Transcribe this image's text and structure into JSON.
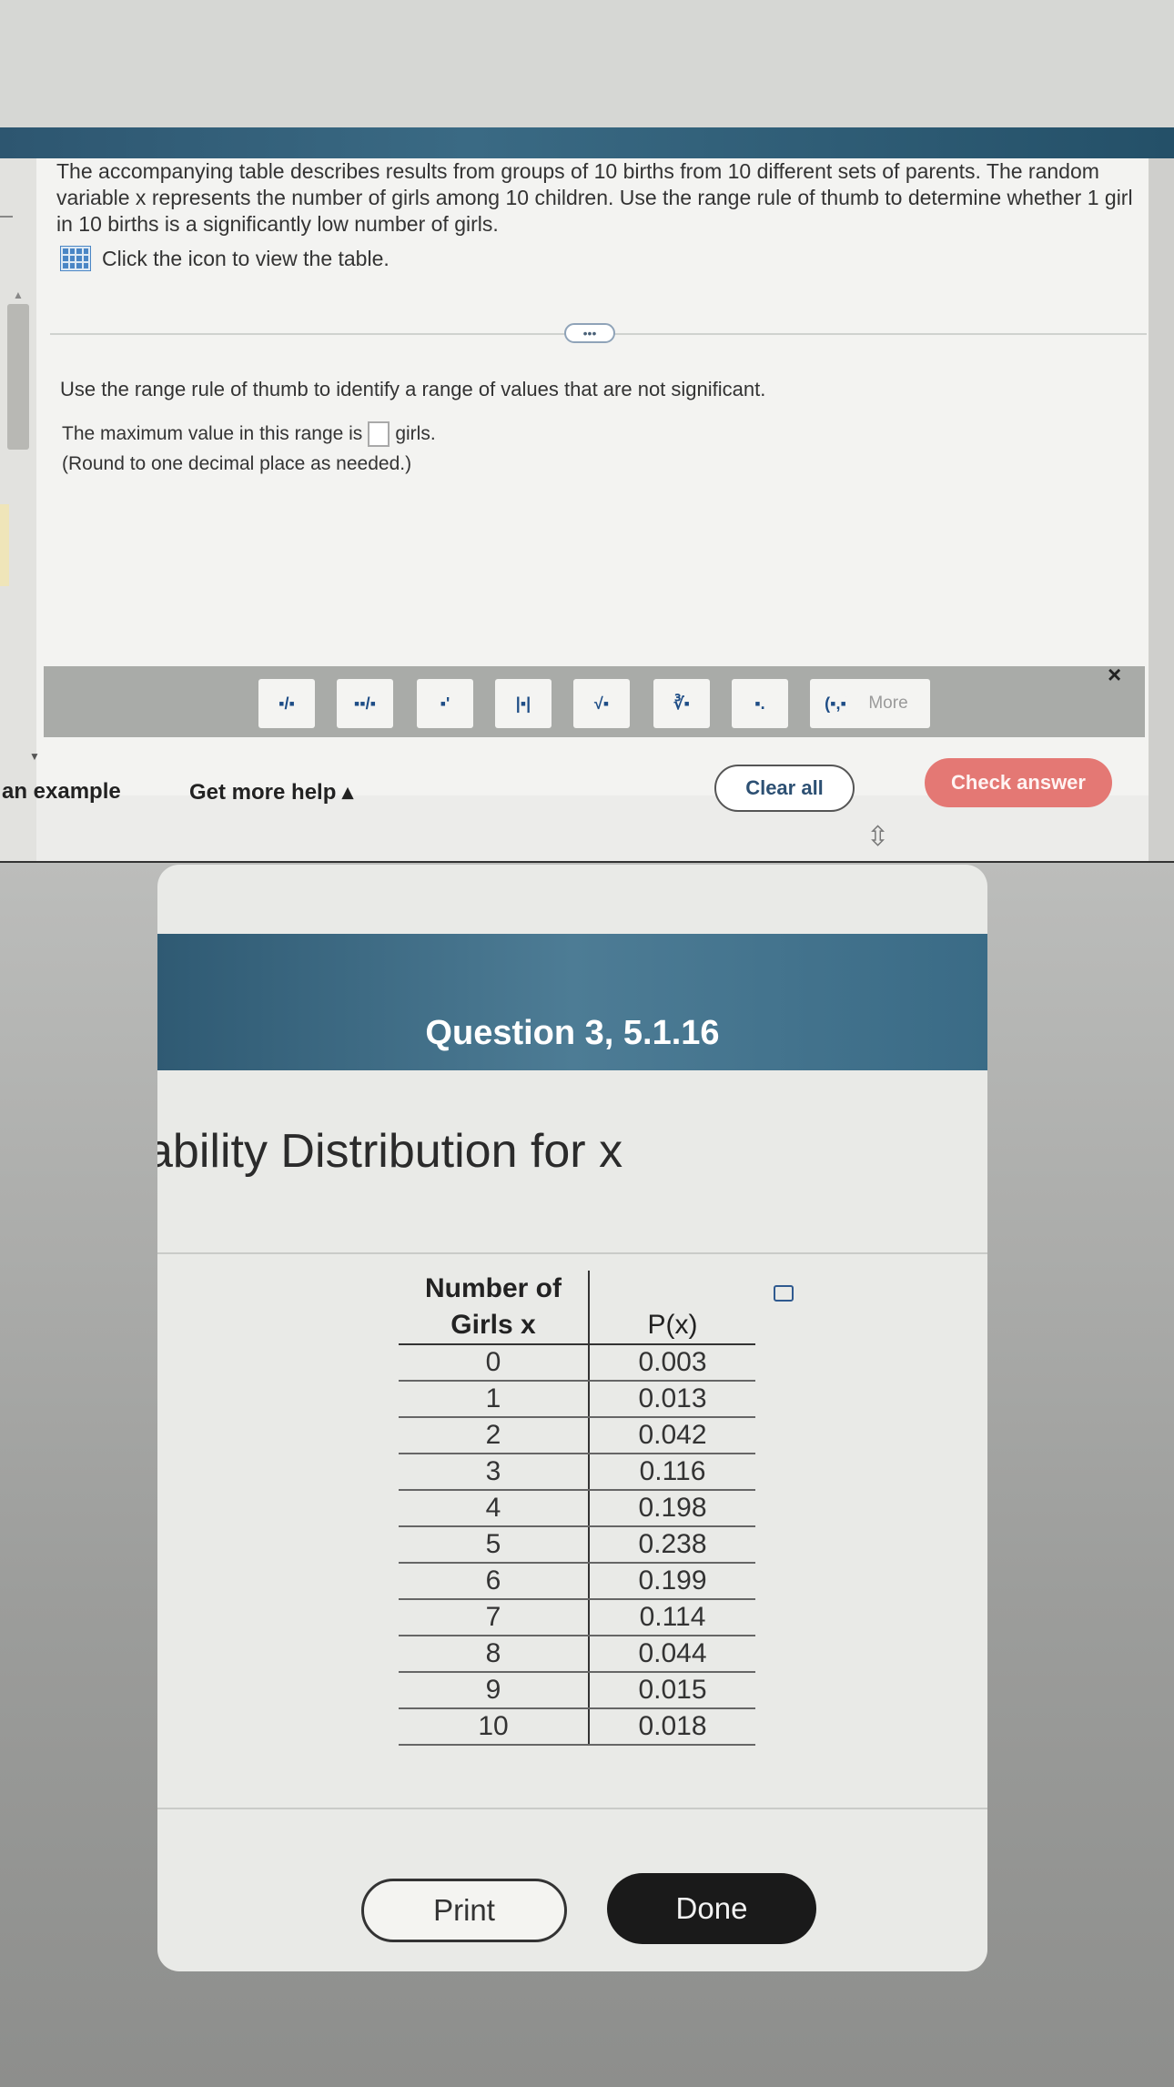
{
  "question": {
    "text": "The accompanying table describes results from groups of 10 births from 10 different sets of parents. The random variable x represents the number of girls among 10 children. Use the range rule of thumb to determine whether 1 girl in 10 births is a significantly low number of girls.",
    "table_link": "Click the icon to view the table.",
    "expand_dots": "•••",
    "instruction": "Use the range rule of thumb to identify a range of values that are not significant.",
    "answer_prefix": "The maximum value in this range is",
    "answer_suffix": "girls.",
    "round_note": "(Round to one decimal place as needed.)"
  },
  "toolbar": {
    "tools": [
      "▪/▪",
      "▪▪/▪",
      "▪'",
      "|▪|",
      "√▪",
      "∛▪",
      "▪.",
      "(▪,▪)"
    ],
    "more_label": "More",
    "close_label": "×"
  },
  "actions": {
    "example_label": "an example",
    "help_label": "Get more help ▴",
    "clear_label": "Clear all",
    "check_label": "Check answer"
  },
  "dialog": {
    "title": "Question 3, 5.1.16",
    "heading": "ability Distribution for x",
    "table": {
      "col1_header_line1": "Number of",
      "col1_header_line2": "Girls x",
      "col2_header": "P(x)",
      "rows": [
        [
          "0",
          "0.003"
        ],
        [
          "1",
          "0.013"
        ],
        [
          "2",
          "0.042"
        ],
        [
          "3",
          "0.116"
        ],
        [
          "4",
          "0.198"
        ],
        [
          "5",
          "0.238"
        ],
        [
          "6",
          "0.199"
        ],
        [
          "7",
          "0.114"
        ],
        [
          "8",
          "0.044"
        ],
        [
          "9",
          "0.015"
        ],
        [
          "10",
          "0.018"
        ]
      ]
    },
    "print_label": "Print",
    "done_label": "Done"
  }
}
